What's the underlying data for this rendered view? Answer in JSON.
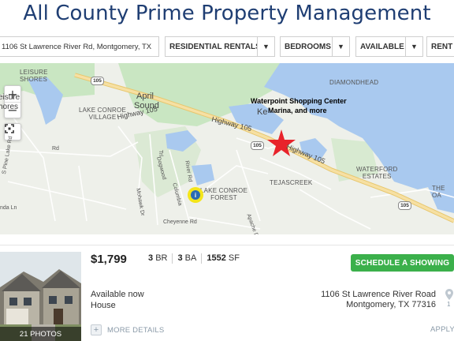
{
  "header": {
    "title": "All County Prime Property Management"
  },
  "filters": {
    "address": "1106 St Lawrence River Rd, Montgomery, TX",
    "category": "RESIDENTIAL RENTALS",
    "bedrooms": "BEDROOMS",
    "availability": "AVAILABLE",
    "rent": "RENT"
  },
  "map": {
    "zoom_in": "+",
    "zoom_out": "−",
    "labels": {
      "leisure_shores_1": "LEISURE",
      "leisure_shores_2": "SHORES",
      "leisure_shores_b1": "eisure",
      "leisure_shores_b2": "hores",
      "lake_conroe_village_1": "LAKE CONROE",
      "lake_conroe_village_2": "VILLAGE",
      "april_sound_1": "April",
      "april_sound_2": "Sound",
      "diamondhead": "DIAMONDHEAD",
      "waterford_1": "WATERFORD",
      "waterford_2": "ESTATES",
      "tejascreek": "TEJASCREEK",
      "lake_conroe_forest_1": "LAKE CONROE",
      "lake_conroe_forest_2": "FOREST",
      "the_oak": "THE OA",
      "keenan": "Ke",
      "highway_105_a": "Highway 105",
      "highway_105_b": "Highway 105",
      "highway_105_c": "Highway 105",
      "shield_105": "105",
      "street_lake": "S Pine Lake Rd",
      "street_trail": "Trl",
      "street_mohawk": "Mohawk Dr",
      "street_dogwood": "Dogwood",
      "street_river": "River Rd",
      "street_columbia": "Columbia",
      "street_cheyenne": "Cheyenne Rd",
      "street_apache": "Apache Dr",
      "street_nda": "nda Ln",
      "street_rd": "Rd"
    },
    "poi_line1": "Waterpoint Shopping Center",
    "poi_line2": "Marina, and more",
    "poi_overlap": "Keenan and more",
    "pin_icon": "i"
  },
  "listing": {
    "photo_count": "21 PHOTOS",
    "price": "$1,799",
    "beds_num": "3",
    "beds_label": "BR",
    "baths_num": "3",
    "baths_label": "BA",
    "sqft_num": "1552",
    "sqft_label": "SF",
    "schedule_button": "SCHEDULE A SHOWING",
    "availability": "Available now",
    "type": "House",
    "address_line1": "1106 St Lawrence River Road",
    "address_line2": "Montgomery, TX 77316",
    "more_details": "MORE DETAILS",
    "apply": "APPLY",
    "plus": "+",
    "pin_count": "1"
  },
  "colors": {
    "title": "#1f3e73",
    "water": "#a9c9ef",
    "park": "#c9e6c2",
    "highway": "#f3d78f",
    "button_green": "#3bb04b",
    "star": "#e8232b"
  }
}
